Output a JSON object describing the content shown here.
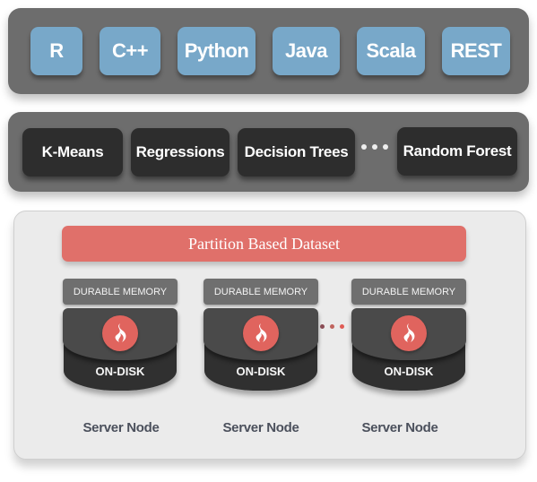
{
  "languages_layer": {
    "items": [
      "R",
      "C++",
      "Python",
      "Java",
      "Scala",
      "REST"
    ]
  },
  "algorithms_layer": {
    "items": [
      "K-Means",
      "Regressions",
      "Decision Trees",
      "Random Forest"
    ],
    "ellipsis": "more algorithms"
  },
  "cluster_layer": {
    "dataset_label": "Partition Based Dataset",
    "nodes": [
      {
        "memory_label": "DURABLE MEMORY",
        "disk_label": "ON-DISK",
        "server_label": "Server Node"
      },
      {
        "memory_label": "DURABLE MEMORY",
        "disk_label": "ON-DISK",
        "server_label": "Server Node"
      },
      {
        "memory_label": "DURABLE MEMORY",
        "disk_label": "ON-DISK",
        "server_label": "Server Node"
      }
    ]
  },
  "colors": {
    "language_tile": "#78a8c9",
    "algorithm_tile": "#2d2d2d",
    "dataset_bar": "#e0706a",
    "flame_badge": "#e0645e",
    "panel_dark": "#6d6d6d",
    "panel_light": "#ebebeb"
  }
}
